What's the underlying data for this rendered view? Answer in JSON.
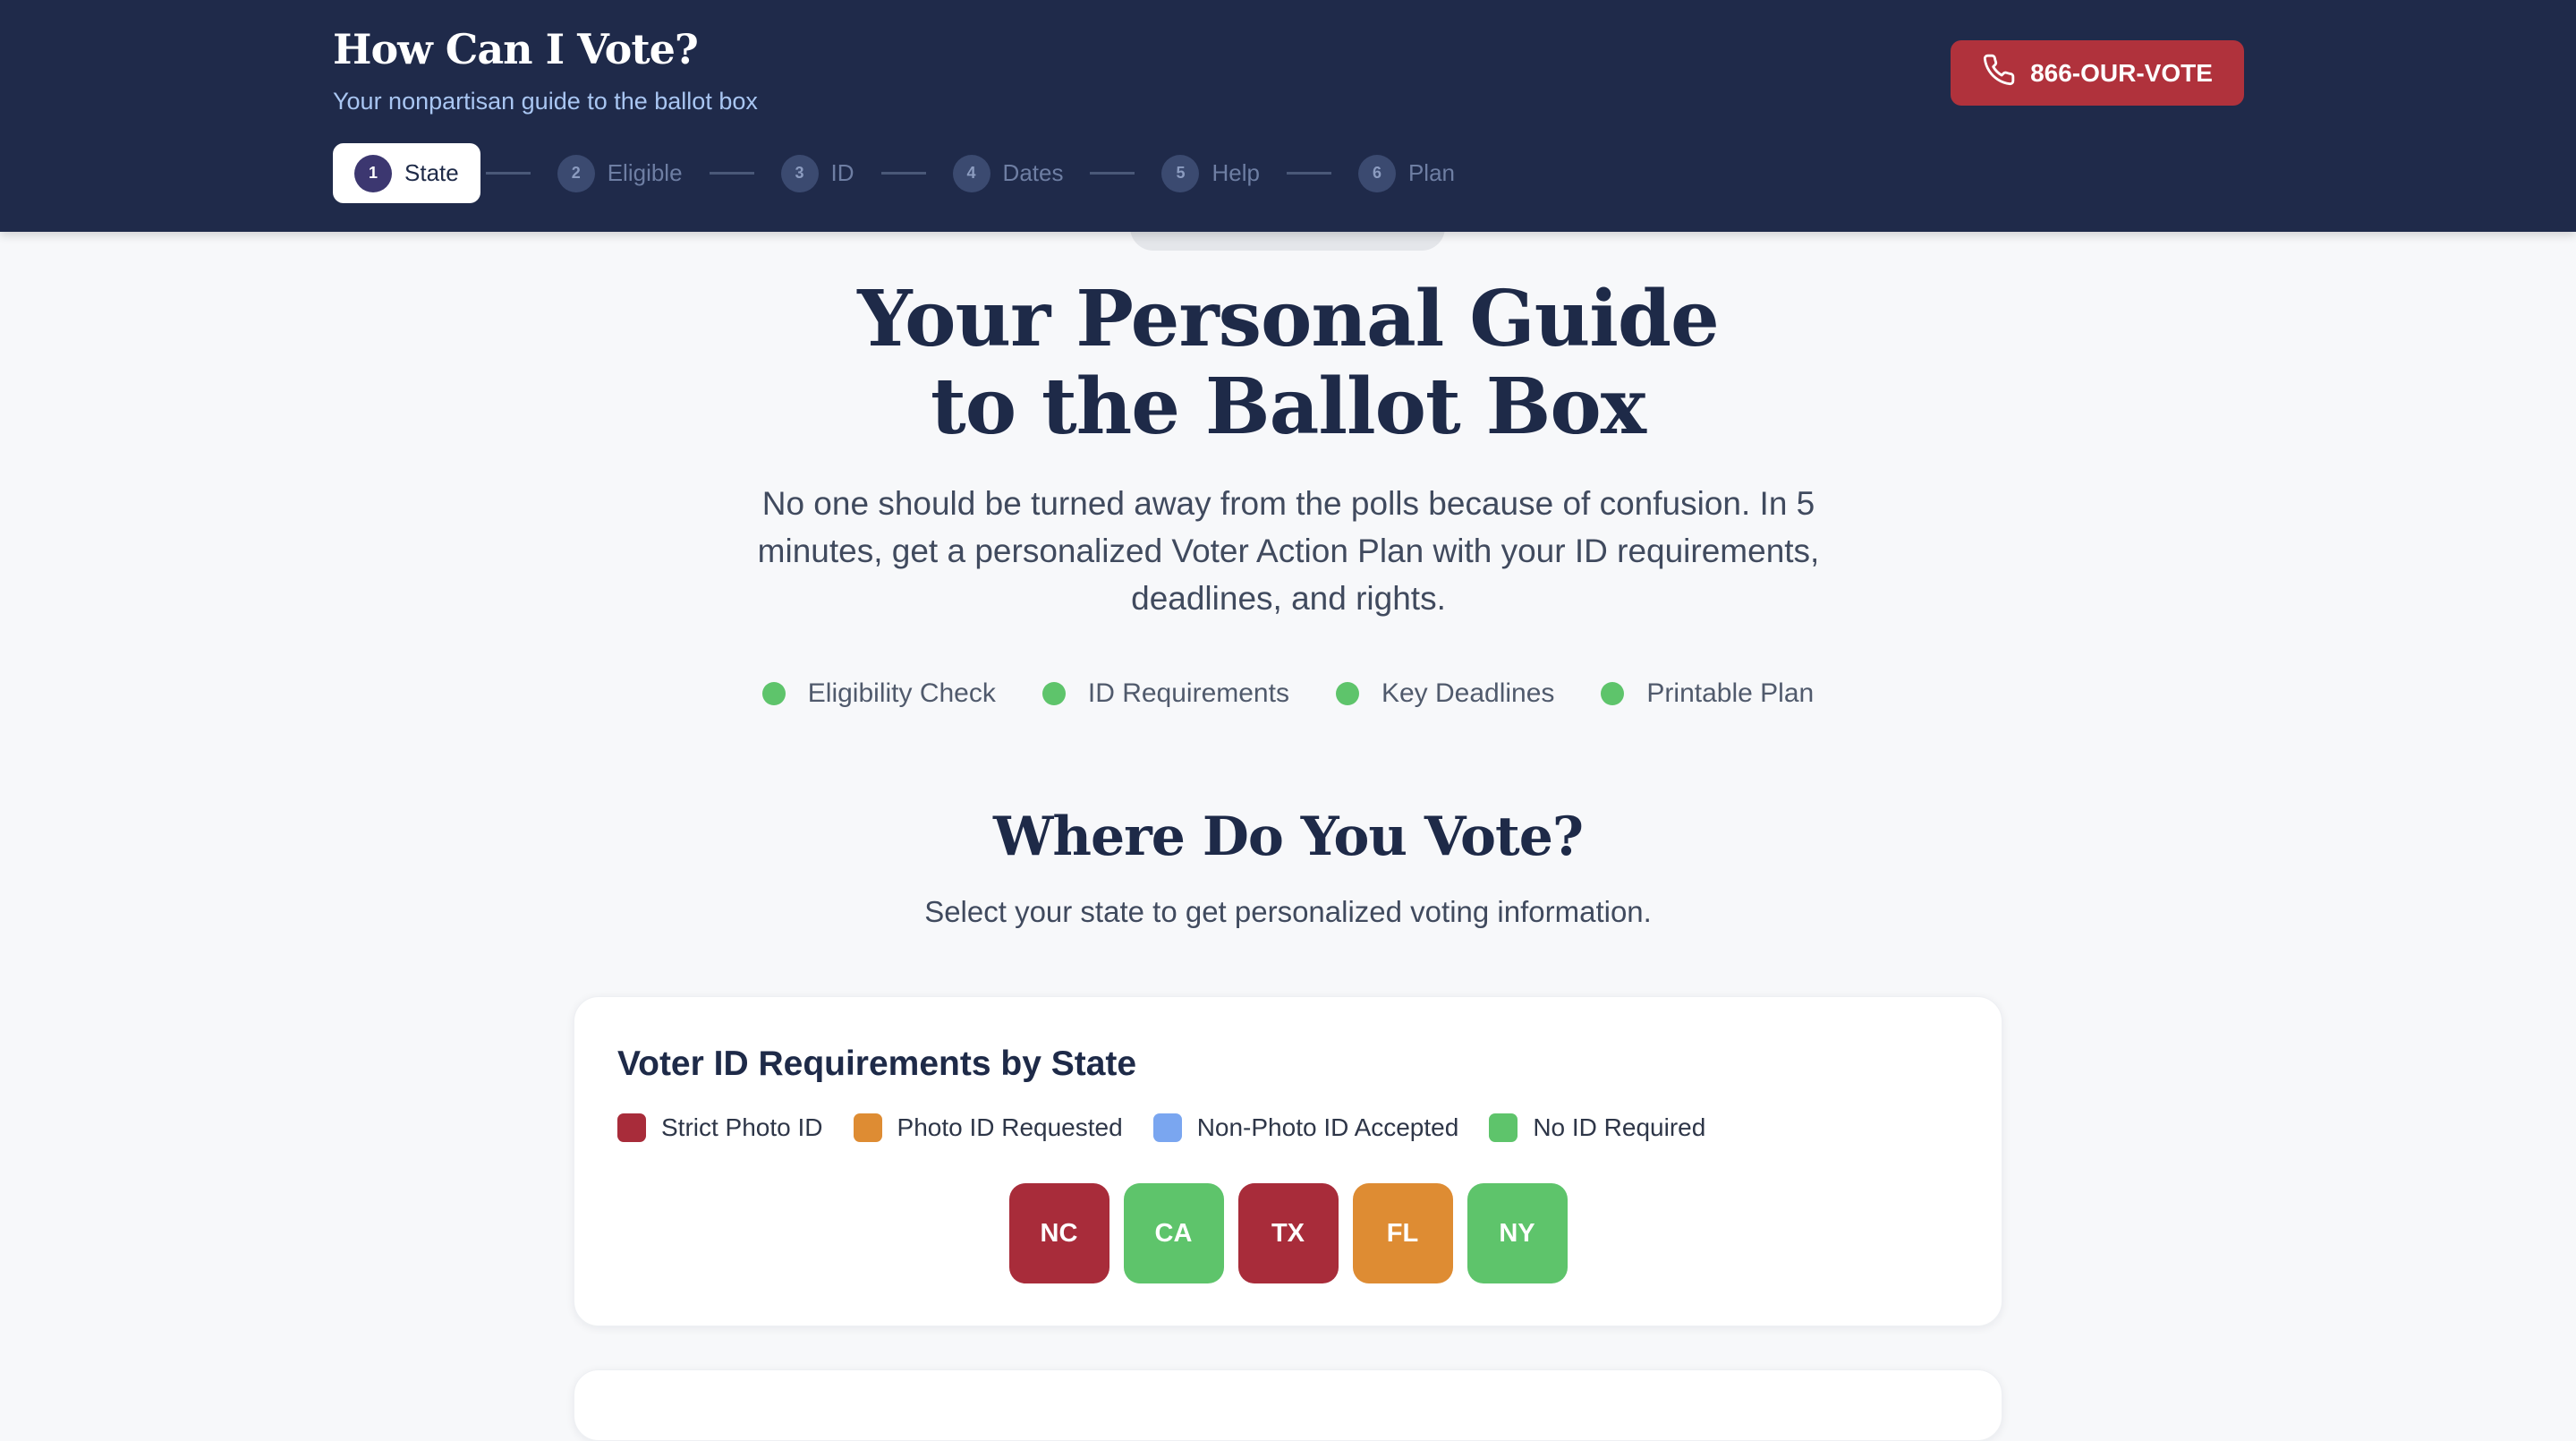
{
  "header": {
    "title": "How Can I Vote?",
    "subtitle": "Your nonpartisan guide to the ballot box",
    "hotline_label": "866-OUR-VOTE"
  },
  "steps": [
    {
      "num": "1",
      "label": "State",
      "active": true
    },
    {
      "num": "2",
      "label": "Eligible",
      "active": false
    },
    {
      "num": "3",
      "label": "ID",
      "active": false
    },
    {
      "num": "4",
      "label": "Dates",
      "active": false
    },
    {
      "num": "5",
      "label": "Help",
      "active": false
    },
    {
      "num": "6",
      "label": "Plan",
      "active": false
    }
  ],
  "hero": {
    "title_line1": "Your Personal Guide",
    "title_line2": "to the Ballot Box",
    "description": "No one should be turned away from the polls because of confusion. In 5 minutes, get a personalized Voter Action Plan with your ID requirements, deadlines, and rights."
  },
  "features": [
    "Eligibility Check",
    "ID Requirements",
    "Key Deadlines",
    "Printable Plan"
  ],
  "section": {
    "title": "Where Do You Vote?",
    "subtitle": "Select your state to get personalized voting information."
  },
  "id_card": {
    "title": "Voter ID Requirements by State",
    "legend": [
      {
        "label": "Strict Photo ID",
        "color": "#a82c3a"
      },
      {
        "label": "Photo ID Requested",
        "color": "#de8c33"
      },
      {
        "label": "Non-Photo ID Accepted",
        "color": "#7aa6f0"
      },
      {
        "label": "No ID Required",
        "color": "#5ec46b"
      }
    ],
    "states": [
      {
        "code": "NC",
        "color": "#a82c3a"
      },
      {
        "code": "CA",
        "color": "#5ec46b"
      },
      {
        "code": "TX",
        "color": "#a82c3a"
      },
      {
        "code": "FL",
        "color": "#de8c33"
      },
      {
        "code": "NY",
        "color": "#5ec46b"
      }
    ]
  },
  "colors": {
    "header_bg": "#1f2a4a",
    "accent_red": "#b0323c",
    "feature_dot": "#5ec46b"
  }
}
